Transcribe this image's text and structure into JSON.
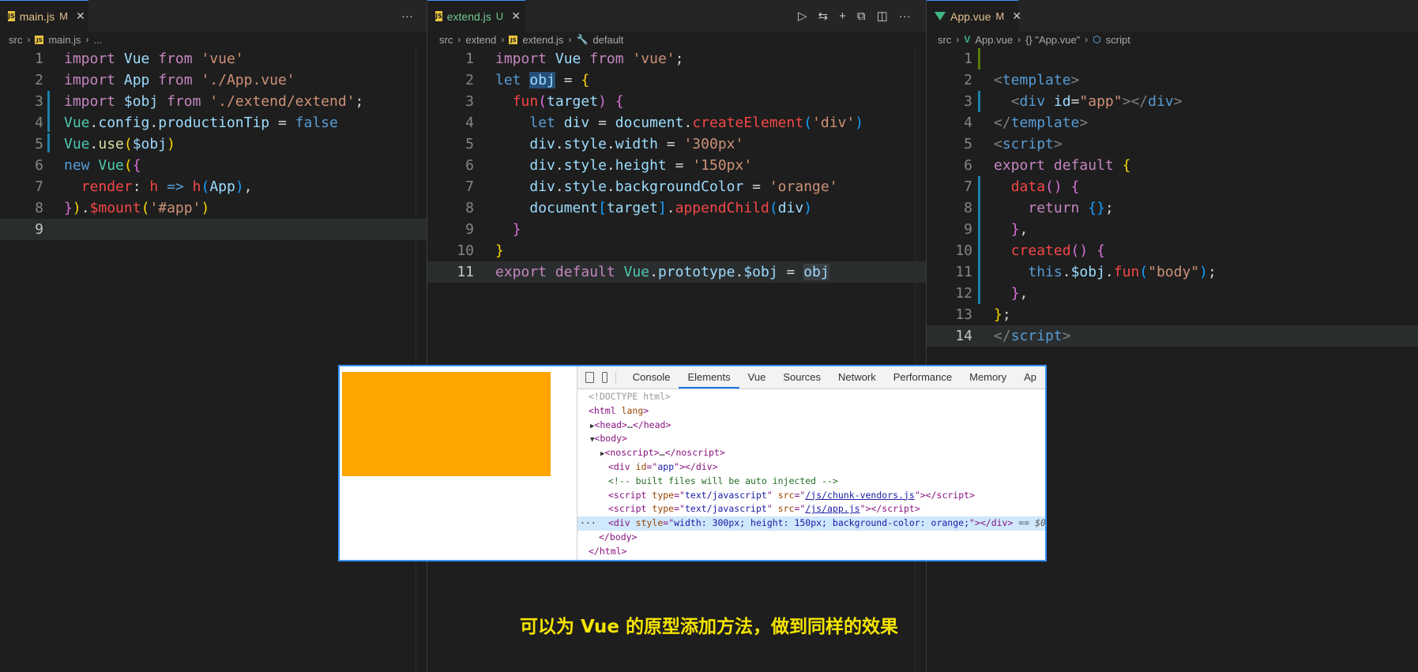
{
  "panes": [
    {
      "tab": {
        "name": "main.js",
        "status": "M"
      },
      "breadcrumb": [
        "src",
        "main.js",
        "..."
      ],
      "more_label": "···",
      "current_line": 9
    },
    {
      "tab": {
        "name": "extend.js",
        "status": "U"
      },
      "breadcrumb": [
        "src",
        "extend",
        "extend.js",
        "default"
      ],
      "more_label": "···",
      "current_line": 11
    },
    {
      "tab": {
        "name": "App.vue",
        "status": "M"
      },
      "breadcrumb": [
        "src",
        "App.vue",
        "{} \"App.vue\"",
        "script"
      ],
      "current_line": 14
    }
  ],
  "main_js_lines": [
    {
      "n": "1"
    },
    {
      "n": "2"
    },
    {
      "n": "3"
    },
    {
      "n": "4"
    },
    {
      "n": "5"
    },
    {
      "n": "6"
    },
    {
      "n": "7"
    },
    {
      "n": "8"
    },
    {
      "n": "9"
    }
  ],
  "extend_js_lines": [
    {
      "n": "1"
    },
    {
      "n": "2"
    },
    {
      "n": "3"
    },
    {
      "n": "4"
    },
    {
      "n": "5"
    },
    {
      "n": "6"
    },
    {
      "n": "7"
    },
    {
      "n": "8"
    },
    {
      "n": "9"
    },
    {
      "n": "10"
    },
    {
      "n": "11"
    }
  ],
  "app_vue_lines": [
    {
      "n": "1"
    },
    {
      "n": "2"
    },
    {
      "n": "3"
    },
    {
      "n": "4"
    },
    {
      "n": "5"
    },
    {
      "n": "6"
    },
    {
      "n": "7"
    },
    {
      "n": "8"
    },
    {
      "n": "9"
    },
    {
      "n": "10"
    },
    {
      "n": "11"
    },
    {
      "n": "12"
    },
    {
      "n": "13"
    },
    {
      "n": "14"
    }
  ],
  "devtools": {
    "tabs": [
      "Console",
      "Elements",
      "Vue",
      "Sources",
      "Network",
      "Performance",
      "Memory",
      "Ap"
    ],
    "active_tab": "Elements",
    "preview_box_color": "#ffa500"
  },
  "caption": "可以为 Vue 的原型添加方法，做到同样的效果"
}
